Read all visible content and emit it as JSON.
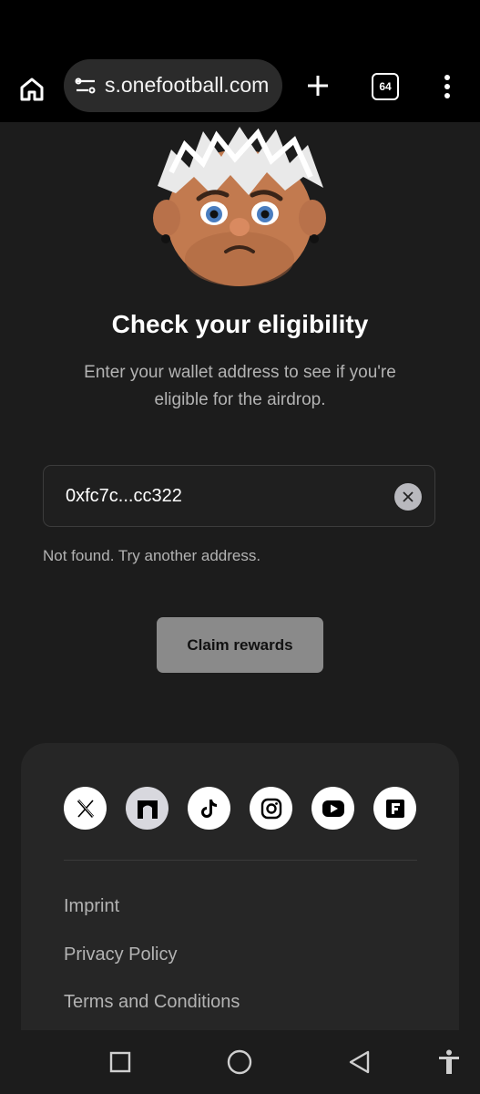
{
  "browser": {
    "url": "s.onefootball.com",
    "tab_count": "64"
  },
  "main": {
    "title": "Check your eligibility",
    "subtitle": "Enter your wallet address to see if you're eligible for the airdrop.",
    "wallet_value": "0xfc7c...cc322",
    "error": "Not found. Try another address.",
    "claim_label": "Claim rewards"
  },
  "footer": {
    "social_icons": [
      "x-icon",
      "arch-icon",
      "tiktok-icon",
      "instagram-icon",
      "youtube-icon",
      "f-icon"
    ],
    "links": [
      "Imprint",
      "Privacy Policy",
      "Terms and Conditions"
    ]
  },
  "colors": {
    "background": "#1c1c1c",
    "footer_card": "#262626",
    "claim_button": "#8a8a8a",
    "muted_text": "#b3b3b3"
  }
}
